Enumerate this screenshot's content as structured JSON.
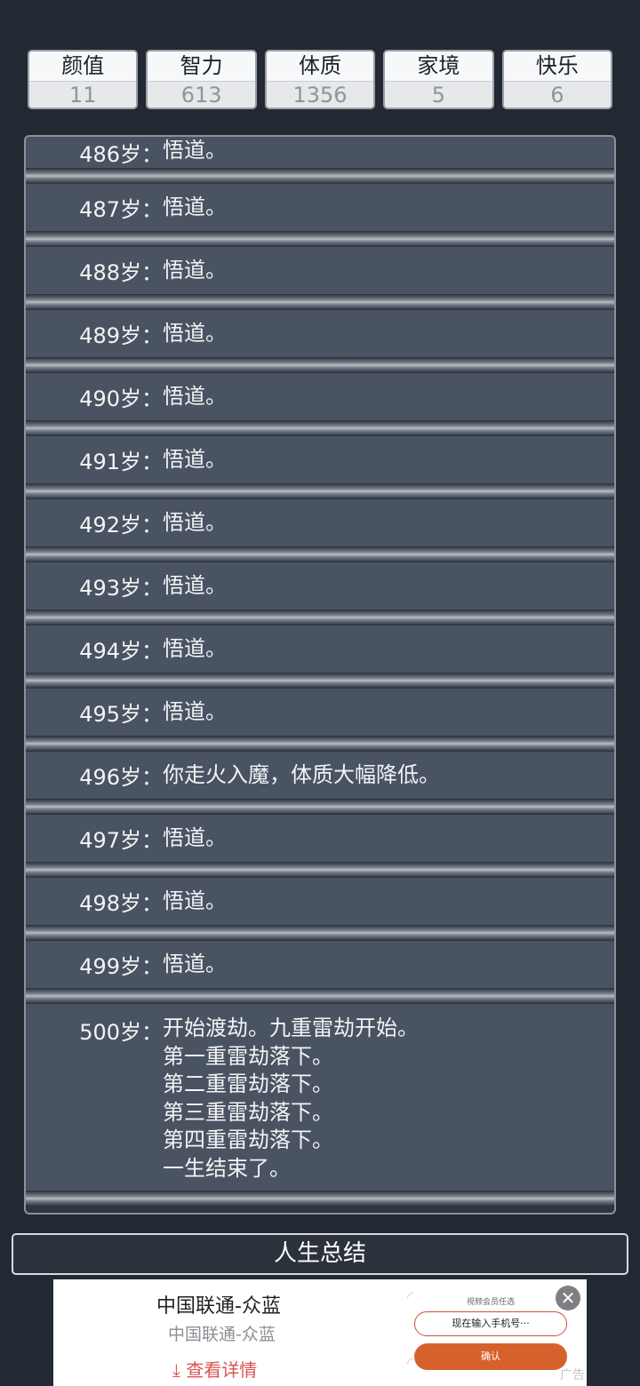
{
  "stats": [
    {
      "name": "颜值",
      "value": "11"
    },
    {
      "name": "智力",
      "value": "613"
    },
    {
      "name": "体质",
      "value": "1356"
    },
    {
      "name": "家境",
      "value": "5"
    },
    {
      "name": "快乐",
      "value": "6"
    }
  ],
  "log": [
    {
      "age": "486岁：",
      "text": "悟道。"
    },
    {
      "age": "487岁：",
      "text": "悟道。"
    },
    {
      "age": "488岁：",
      "text": "悟道。"
    },
    {
      "age": "489岁：",
      "text": "悟道。"
    },
    {
      "age": "490岁：",
      "text": "悟道。"
    },
    {
      "age": "491岁：",
      "text": "悟道。"
    },
    {
      "age": "492岁：",
      "text": "悟道。"
    },
    {
      "age": "493岁：",
      "text": "悟道。"
    },
    {
      "age": "494岁：",
      "text": "悟道。"
    },
    {
      "age": "495岁：",
      "text": "悟道。"
    },
    {
      "age": "496岁：",
      "text": "你走火入魔，体质大幅降低。"
    },
    {
      "age": "497岁：",
      "text": "悟道。"
    },
    {
      "age": "498岁：",
      "text": "悟道。"
    },
    {
      "age": "499岁：",
      "text": "悟道。"
    },
    {
      "age": "500岁：",
      "text": "开始渡劫。九重雷劫开始。\n第一重雷劫落下。\n第二重雷劫落下。\n第三重雷劫落下。\n第四重雷劫落下。\n一生结束了。"
    }
  ],
  "summary_button": "人生总结",
  "ad": {
    "title": "中国联通-众蓝",
    "subtitle": "中国联通-众蓝",
    "cta": "查看详情",
    "small_text": "视频会员任选",
    "input_placeholder": "现在输入手机号···",
    "confirm": "确认",
    "tag": "广告"
  }
}
